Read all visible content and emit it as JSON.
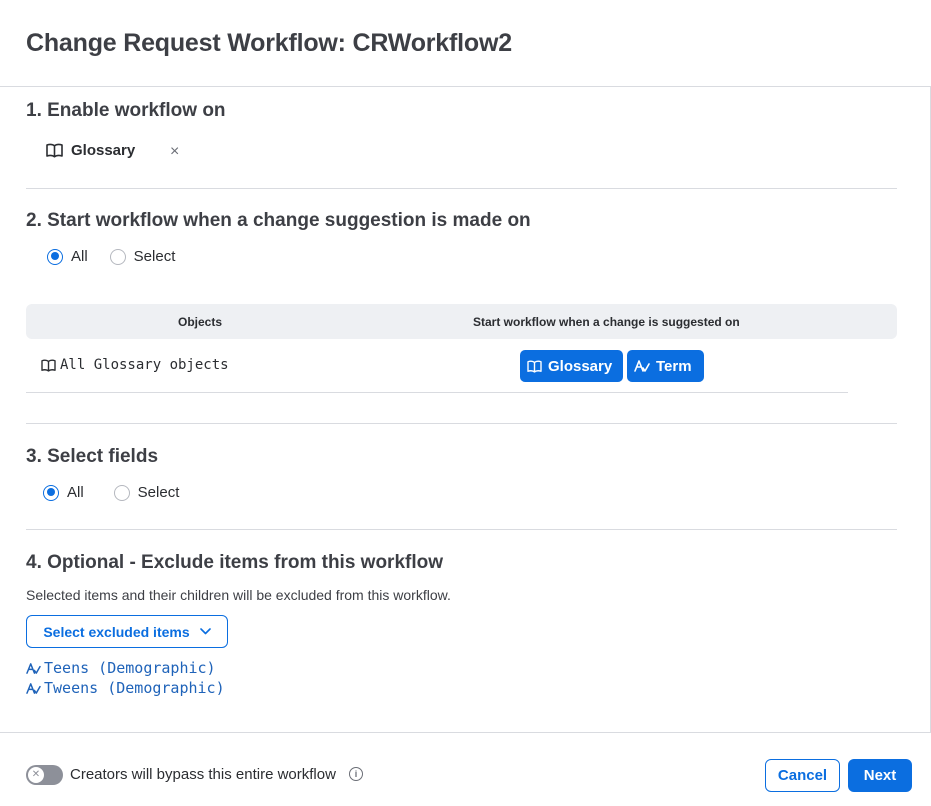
{
  "dialog": {
    "title": "Change Request Workflow: CRWorkflow2"
  },
  "section1": {
    "title": "1. Enable workflow on",
    "chip_label": "Glossary",
    "remove_glyph": "×"
  },
  "section2": {
    "title": "2. Start workflow when a change suggestion is made on",
    "options": [
      {
        "label": "All",
        "selected": true
      },
      {
        "label": "Select",
        "selected": false
      }
    ],
    "table": {
      "headers": [
        "Objects",
        "Start workflow when a change is suggested on"
      ],
      "rows": [
        {
          "object": "All Glossary objects",
          "tags": [
            "Glossary",
            "Term"
          ]
        }
      ]
    }
  },
  "section3": {
    "title": "3. Select fields",
    "options": [
      {
        "label": "All",
        "selected": true
      },
      {
        "label": "Select",
        "selected": false
      }
    ]
  },
  "section4": {
    "title": "4. Optional - Exclude items from this workflow",
    "hint": "Selected items and their children will be excluded from this workflow.",
    "select_button": "Select excluded items",
    "excluded_items": [
      "Teens (Demographic)",
      "Tweens (Demographic)"
    ]
  },
  "footer": {
    "toggle_label": "Creators will bypass this entire workflow",
    "toggle_on": false,
    "cancel": "Cancel",
    "next": "Next"
  },
  "icons": {
    "glossary": "book-icon",
    "term": "term-icon",
    "info": "info-icon",
    "chevron": "chevron-down-icon"
  },
  "colors": {
    "accent": "#0b6ee0",
    "link": "#1f63b9",
    "text": "#3d3f45",
    "divider": "#d9dbe0"
  }
}
